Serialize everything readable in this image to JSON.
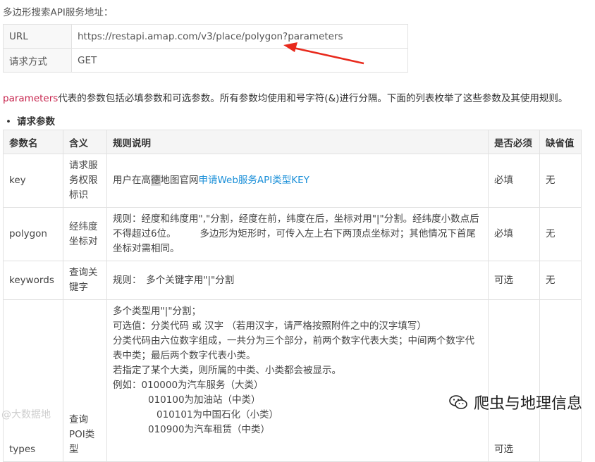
{
  "title": "多边形搜索API服务地址：",
  "url_table": {
    "rows": [
      {
        "key": "URL",
        "value": "https://restapi.amap.com/v3/place/polygon?parameters"
      },
      {
        "key": "请求方式",
        "value": "GET"
      }
    ]
  },
  "description": {
    "highlight": "parameters",
    "text": "代表的参数包括必填参数和可选参数。所有参数均使用和号字符(&)进行分隔。下面的列表枚举了这些参数及其使用规则。"
  },
  "section_title": "请求参数",
  "param_table": {
    "headers": [
      "参数名",
      "含义",
      "规则说明",
      "是否必须",
      "缺省值"
    ],
    "rows": [
      {
        "name": "key",
        "meaning": "请求服务权限标识",
        "rule_pre": "用户在高",
        "rule_sel": "德",
        "rule_mid": "地图官网",
        "rule_link": "申请Web服务API类型KEY",
        "required": "必填",
        "default": "无"
      },
      {
        "name": "polygon",
        "meaning": "经纬度坐标对",
        "rule": "规则：经度和纬度用\",\"分割，经度在前，纬度在后，坐标对用\"|\"分割。经纬度小数点后不得超过6位。　　　多边形为矩形时，可传入左上右下两顶点坐标对；其他情况下首尾坐标对需相同。",
        "required": "必填",
        "default": "无"
      },
      {
        "name": "keywords",
        "meaning": "查询关键字",
        "rule": "规则：　多个关键字用\"|\"分割",
        "required": "可选",
        "default": "无"
      },
      {
        "name": "types",
        "meaning": "查询POI类型",
        "rule_lines": [
          "多个类型用\"|\"分割；",
          "可选值：分类代码 或 汉字 （若用汉字，请严格按照附件之中的汉字填写）",
          "分类代码由六位数字组成，一共分为三个部分，前两个数字代表大类；中间两个数字代表中类；最后两个数字代表小类。",
          "若指定了某个大类，则所属的中类、小类都会被显示。",
          "例如：010000为汽车服务（大类）"
        ],
        "rule_indent_lines": [
          "010100为加油站（中类）",
          "010101为中国石化（小类）",
          "010900为汽车租赁（中类）"
        ],
        "required": "可选",
        "default": ""
      }
    ]
  },
  "watermark_left": "@大数据地",
  "watermark_right": "爬虫与地理信息"
}
